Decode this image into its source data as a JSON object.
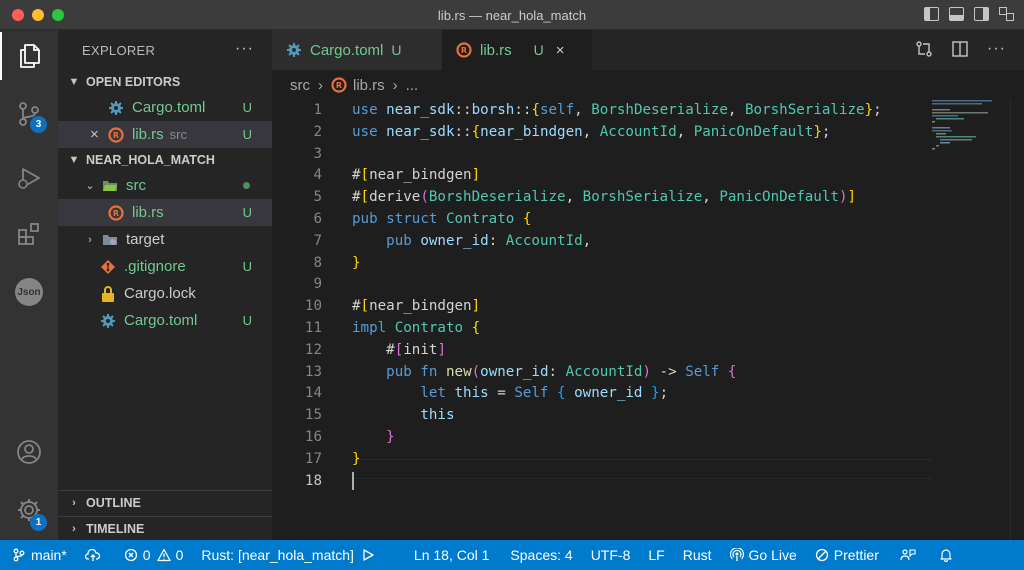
{
  "window": {
    "title": "lib.rs — near_hola_match"
  },
  "activity_bar": {
    "scm_badge": "3",
    "accounts_badge": "1",
    "json_label": "Json"
  },
  "sidebar": {
    "title": "EXPLORER",
    "more": "···",
    "open_editors": {
      "header": "OPEN EDITORS",
      "items": [
        {
          "name": "Cargo.toml",
          "status": "U",
          "close": ""
        },
        {
          "name": "lib.rs",
          "description": "src",
          "status": "U",
          "close": "×"
        }
      ]
    },
    "project": {
      "header": "NEAR_HOLA_MATCH",
      "items": [
        {
          "name": "src",
          "kind": "folder-open"
        },
        {
          "name": "lib.rs",
          "status": "U"
        },
        {
          "name": "target",
          "kind": "folder"
        },
        {
          "name": ".gitignore",
          "status": "U"
        },
        {
          "name": "Cargo.lock"
        },
        {
          "name": "Cargo.toml",
          "status": "U"
        }
      ]
    },
    "outline": "OUTLINE",
    "timeline": "TIMELINE"
  },
  "tabs": [
    {
      "label": "Cargo.toml",
      "status": "U"
    },
    {
      "label": "lib.rs",
      "status": "U",
      "close": "×"
    }
  ],
  "breadcrumb": {
    "folder": "src",
    "file": "lib.rs",
    "more": "..."
  },
  "editor": {
    "line_numbers": [
      "1",
      "2",
      "3",
      "4",
      "5",
      "6",
      "7",
      "8",
      "9",
      "10",
      "11",
      "12",
      "13",
      "14",
      "15",
      "16",
      "17",
      "18"
    ],
    "current_line": "18"
  },
  "statusbar": {
    "branch": "main*",
    "errors": "0",
    "warnings": "0",
    "rust_project": "Rust: [near_hola_match]",
    "position": "Ln 18, Col 1",
    "spaces": "Spaces: 4",
    "encoding": "UTF-8",
    "eol": "LF",
    "language": "Rust",
    "go_live": "Go Live",
    "prettier": "Prettier"
  },
  "colors": {
    "statusbar": "#007acc",
    "activitybar": "#333333",
    "sidebar": "#252526",
    "editor": "#1e1e1e",
    "untracked": "#73c991",
    "rust_icon": "#e8703a",
    "toml_icon": "#519aba"
  },
  "icons": {
    "explorer": "files-icon",
    "scm": "source-control-icon",
    "debug": "run-debug-icon",
    "extensions": "extensions-icon",
    "json": "json-icon",
    "accounts": "account-icon",
    "manage": "gear-icon"
  }
}
